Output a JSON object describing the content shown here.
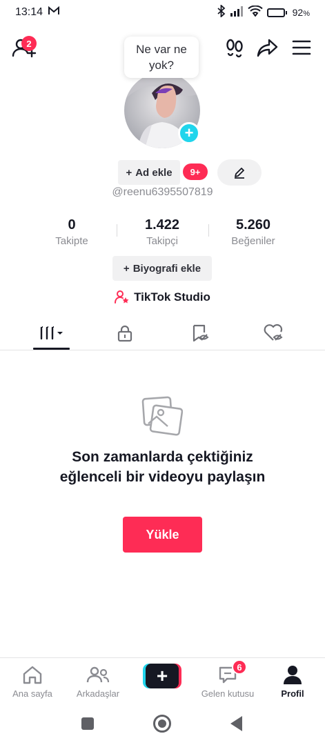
{
  "status_bar": {
    "time": "13:14",
    "battery": "92",
    "battery_unit": "%",
    "battery_level": 0.92
  },
  "header": {
    "friend_requests_badge": "2"
  },
  "profile": {
    "status_bubble": "Ne var ne yok?",
    "add_name_label": "Ad ekle",
    "notification_badge": "9+",
    "username": "@reenu6395507819"
  },
  "stats": [
    {
      "value": "0",
      "label": "Takipte"
    },
    {
      "value": "1.422",
      "label": "Takipçi"
    },
    {
      "value": "5.260",
      "label": "Beğeniler"
    }
  ],
  "bio_button": "Biyografi ekle",
  "studio_label": "TikTok Studio",
  "empty_state": {
    "message": "Son zamanlarda çektiğiniz eğlenceli bir videoyu paylaşın",
    "upload_button": "Yükle"
  },
  "bottom_nav": {
    "items": [
      {
        "label": "Ana sayfa",
        "icon": "home-icon"
      },
      {
        "label": "Arkadaşlar",
        "icon": "friends-icon"
      },
      {
        "label": "",
        "icon": "create-icon"
      },
      {
        "label": "Gelen kutusu",
        "icon": "inbox-icon"
      },
      {
        "label": "Profil",
        "icon": "profile-icon"
      }
    ],
    "inbox_badge": "6"
  },
  "colors": {
    "accent": "#fe2c55",
    "cyan": "#20d5ec",
    "text": "#161823",
    "muted": "#8a8b91"
  }
}
